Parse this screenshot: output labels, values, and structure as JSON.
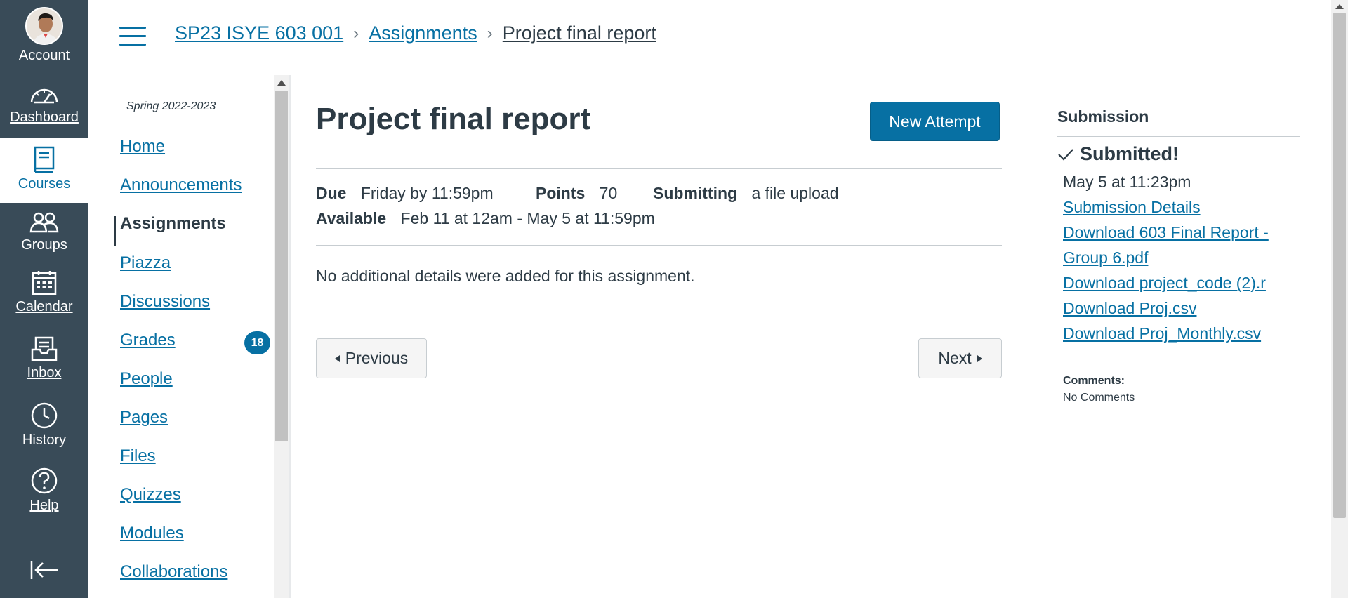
{
  "global_nav": {
    "account": "Account",
    "dashboard": "Dashboard",
    "courses": "Courses",
    "groups": "Groups",
    "calendar": "Calendar",
    "inbox": "Inbox",
    "history": "History",
    "help": "Help",
    "icons": [
      "avatar",
      "dashboard-icon",
      "courses-icon",
      "groups-icon",
      "calendar-icon",
      "inbox-icon",
      "history-icon",
      "help-icon",
      "collapse-nav-icon"
    ]
  },
  "breadcrumb": {
    "course": "SP23 ISYE 603 001",
    "section": "Assignments",
    "current": "Project final report"
  },
  "course_nav": {
    "term": "Spring 2022-2023",
    "items": [
      "Home",
      "Announcements",
      "Assignments",
      "Piazza",
      "Discussions",
      "Grades",
      "People",
      "Pages",
      "Files",
      "Quizzes",
      "Modules",
      "Collaborations"
    ],
    "active": "Assignments",
    "grades_badge": "18"
  },
  "assignment": {
    "title": "Project final report",
    "new_attempt_label": "New Attempt",
    "due_label": "Due",
    "due_value": "Friday by 11:59pm",
    "points_label": "Points",
    "points_value": "70",
    "submitting_label": "Submitting",
    "submitting_value": "a file upload",
    "available_label": "Available",
    "available_value": "Feb 11 at 12am - May 5 at 11:59pm",
    "details": "No additional details were added for this assignment."
  },
  "pager": {
    "previous": "Previous",
    "next": "Next"
  },
  "submission": {
    "heading": "Submission",
    "status": "Submitted!",
    "date": "May 5 at 11:23pm",
    "details_link": "Submission Details",
    "download_1_line1": "Download 603 Final Report -",
    "download_1_line2": "Group 6.pdf",
    "download_2": "Download project_code (2).r",
    "download_3": "Download Proj.csv",
    "download_4": "Download Proj_Monthly.csv",
    "comments_label": "Comments:",
    "comments_value": "No Comments"
  },
  "colors": {
    "nav_background": "#394b58",
    "link": "#0770a3",
    "primary_button": "#0770a3",
    "text": "#2d3b45"
  }
}
